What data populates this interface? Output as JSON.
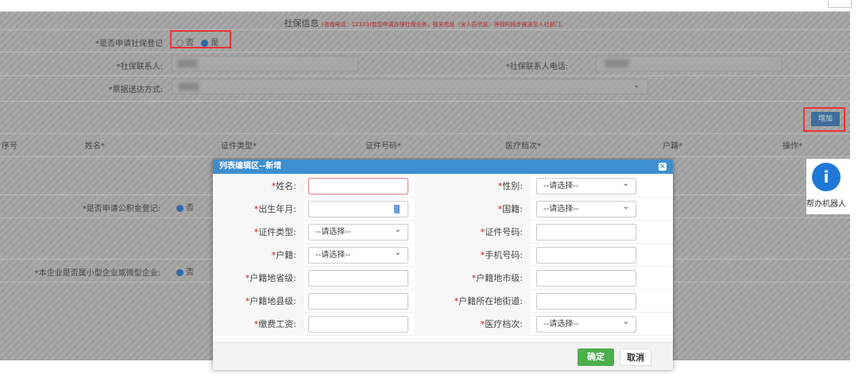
{
  "background": {
    "section_title": "社保信息",
    "section_note": "(咨询电话：12333)若您申请办理社保业务，相关信息（含人员信息）将同时同步推送至人社部门。",
    "apply_social_label": "*是否申请社保登记",
    "apply_social_no": "否",
    "apply_social_yes": "是",
    "contact_label": "*社保联系人:",
    "contact_phone_label": "*社保联系人电话:",
    "delivery_label": "*票据送达方式:",
    "add_button": "增加",
    "table_headers": [
      "序号",
      "姓名*",
      "证件类型*",
      "证件号码*",
      "医疗档次*",
      "户籍*",
      "操作*"
    ],
    "housing_fund_label": "*是否申请公积金登记:",
    "housing_fund_value": "否",
    "small_enterprise_label": "*本企业是否属小型企业或微型企业:",
    "small_enterprise_value": "否",
    "robot_label": "帮办机器人"
  },
  "dialog": {
    "title": "列表编辑区--新增",
    "placeholder_select": "--请选择--",
    "rows": [
      [
        {
          "label": "姓名:",
          "type": "text"
        },
        {
          "label": "性别:",
          "type": "select"
        }
      ],
      [
        {
          "label": "出生年月:",
          "type": "date"
        },
        {
          "label": "国籍:",
          "type": "select"
        }
      ],
      [
        {
          "label": "证件类型:",
          "type": "select"
        },
        {
          "label": "证件号码:",
          "type": "text"
        }
      ],
      [
        {
          "label": "户籍:",
          "type": "select"
        },
        {
          "label": "手机号码:",
          "type": "text"
        }
      ],
      [
        {
          "label": "户籍地省级:",
          "type": "text"
        },
        {
          "label": "户籍地市级:",
          "type": "text"
        }
      ],
      [
        {
          "label": "户籍地县级:",
          "type": "text"
        },
        {
          "label": "户籍所在地街道:",
          "type": "text"
        }
      ],
      [
        {
          "label": "缴费工资:",
          "type": "text"
        },
        {
          "label": "医疗档次:",
          "type": "select"
        }
      ]
    ],
    "confirm": "确定",
    "cancel": "取消"
  }
}
